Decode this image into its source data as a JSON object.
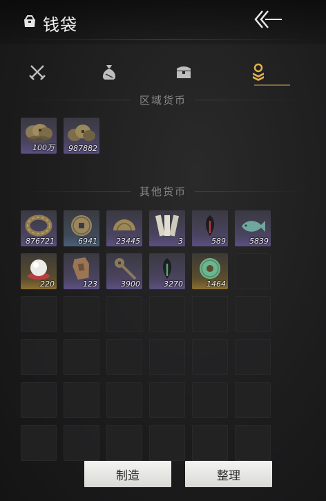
{
  "header": {
    "title": "钱袋",
    "title_icon": "pouch-icon",
    "back_icon": "back-arrows-icon"
  },
  "tabs": [
    {
      "icon": "crossed-swords-icon",
      "active": false
    },
    {
      "icon": "sack-icon",
      "active": false
    },
    {
      "icon": "chest-icon",
      "active": false
    },
    {
      "icon": "coin-stack-icon",
      "active": true
    }
  ],
  "sections": {
    "regional": {
      "label": "区域货币",
      "items": [
        {
          "icon": "copper-coin-string-icon",
          "count": "100万",
          "quality": "purple"
        },
        {
          "icon": "copper-coin-pile-icon",
          "count": "987882",
          "quality": "purple"
        }
      ]
    },
    "other": {
      "label": "其他货币",
      "items": [
        {
          "icon": "coin-ring-icon",
          "count": "876721",
          "quality": "purple"
        },
        {
          "icon": "square-hole-coin-icon",
          "count": "6941",
          "quality": "blue"
        },
        {
          "icon": "half-coin-icon",
          "count": "23445",
          "quality": "purple"
        },
        {
          "icon": "jade-tablets-icon",
          "count": "3",
          "quality": "purple"
        },
        {
          "icon": "dark-feather-icon",
          "count": "589",
          "quality": "purple"
        },
        {
          "icon": "jade-fish-icon",
          "count": "5839",
          "quality": "purple"
        },
        {
          "icon": "pearl-icon",
          "count": "220",
          "quality": "gold"
        },
        {
          "icon": "token-plaque-icon",
          "count": "123",
          "quality": "purple"
        },
        {
          "icon": "coin-sword-icon",
          "count": "3900",
          "quality": "purple"
        },
        {
          "icon": "green-feather-icon",
          "count": "3270",
          "quality": "purple"
        },
        {
          "icon": "jade-bi-disc-icon",
          "count": "1464",
          "quality": "gold"
        }
      ]
    }
  },
  "buttons": {
    "craft": "制造",
    "sort": "整理"
  },
  "colors": {
    "accent": "#7d6a3b",
    "active_tab": "#e0b24a",
    "inactive_tab": "#bdbdbd",
    "purple": "#5d4f83",
    "blue": "#48607a",
    "gold": "#8d7030"
  }
}
